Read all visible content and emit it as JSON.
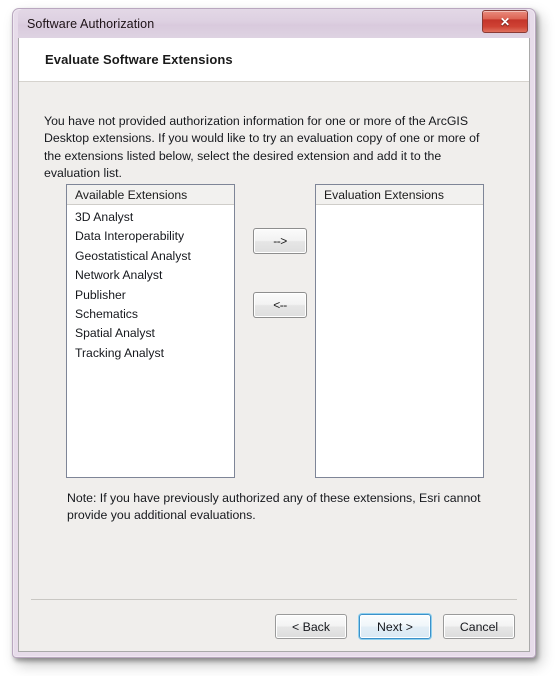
{
  "window": {
    "title": "Software Authorization",
    "close_icon": "close-icon",
    "close_glyph": "✕"
  },
  "header": {
    "title": "Evaluate Software Extensions"
  },
  "intro": {
    "text": "You have not provided authorization information for one or more of the ArcGIS Desktop extensions.  If you would like to try an evaluation copy of one or more of the extensions listed below, select the desired extension and add it to the evaluation list."
  },
  "available_list": {
    "header": "Available Extensions",
    "items": [
      "3D Analyst",
      "Data Interoperability",
      "Geostatistical Analyst",
      "Network Analyst",
      "Publisher",
      "Schematics",
      "Spatial Analyst",
      "Tracking Analyst"
    ]
  },
  "evaluation_list": {
    "header": "Evaluation Extensions",
    "items": []
  },
  "transfer": {
    "add_label": "-->",
    "remove_label": "<--"
  },
  "note": {
    "text": "Note:  If you have previously authorized any of these extensions, Esri cannot provide you additional evaluations."
  },
  "footer": {
    "back_label": "< Back",
    "next_label": "Next >",
    "cancel_label": "Cancel"
  },
  "colors": {
    "titlebar": "#ddd0e1",
    "frame_border": "#b9a7bf",
    "body_panel": "#f0eeec",
    "close_button": "#c4352a",
    "default_button_focus": "#3c91c9",
    "listbox_border": "#7e8597"
  }
}
